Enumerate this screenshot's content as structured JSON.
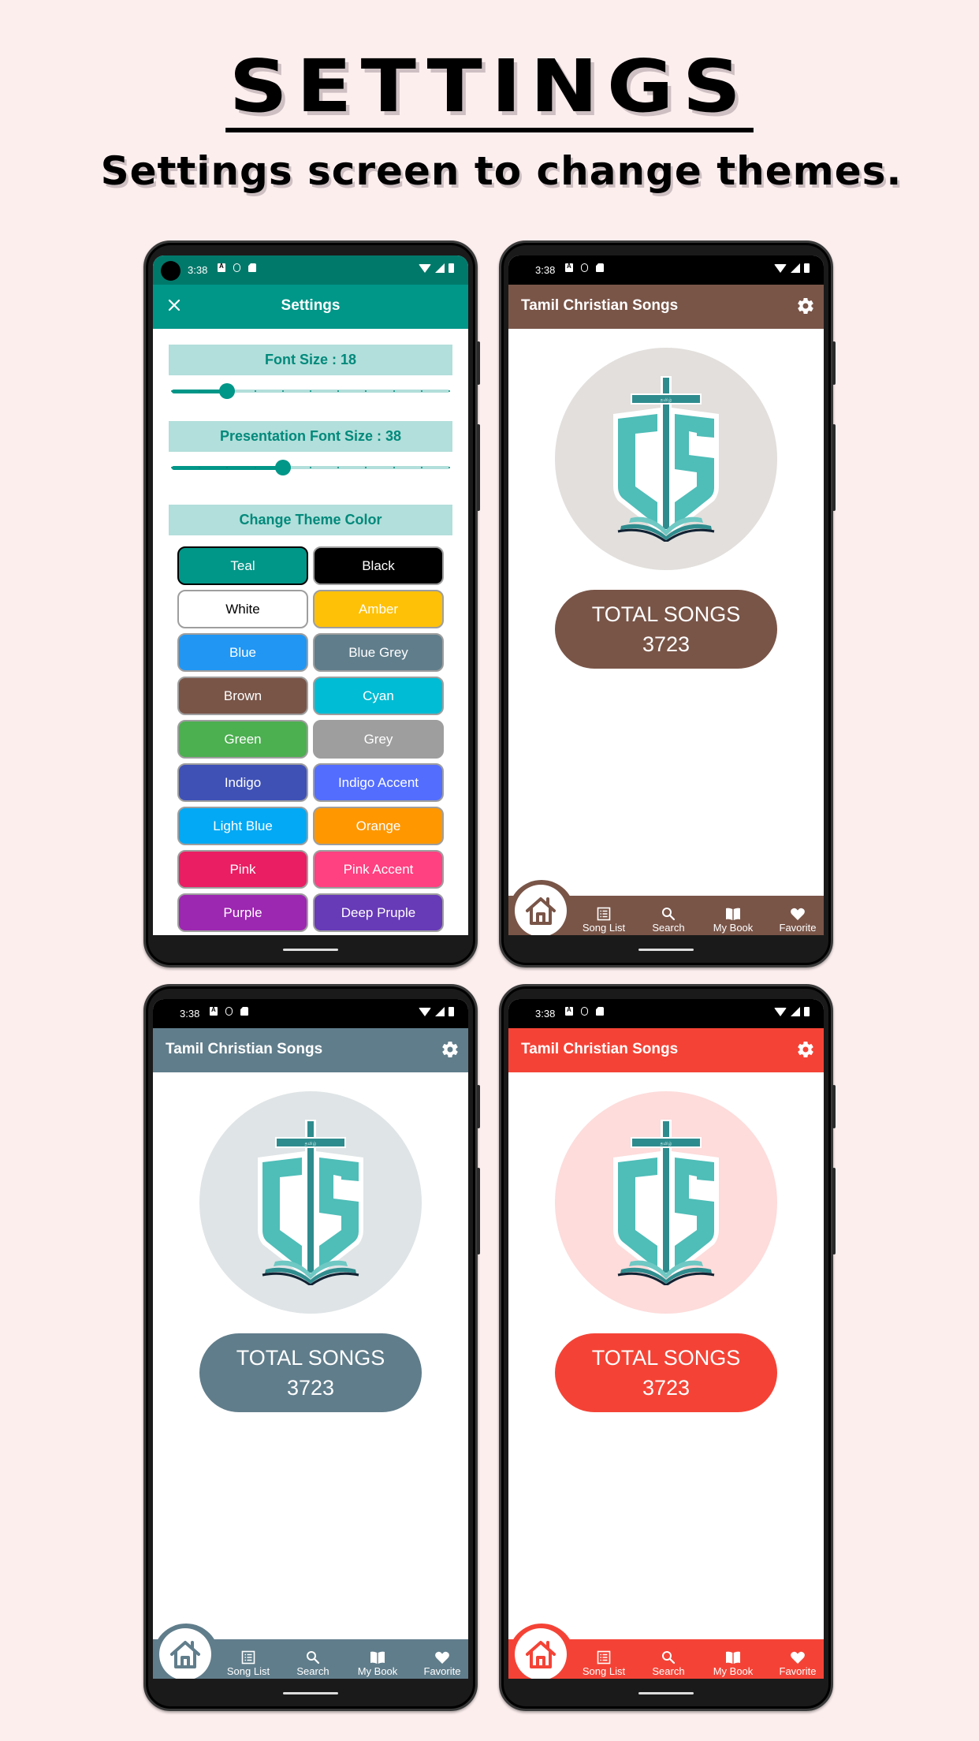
{
  "hero": {
    "title": "SETTINGS",
    "subtitle": "Settings screen to change themes."
  },
  "status_bar": {
    "time": "3:38"
  },
  "settings_screen": {
    "theme_color": "#009688",
    "status_color": "#00796b",
    "title": "Settings",
    "close_icon": "close-icon",
    "font_size_label": "Font Size : 18",
    "font_size_slider_fraction": 0.2,
    "presentation_font_label": "Presentation Font Size : 38",
    "presentation_slider_fraction": 0.4,
    "slider_steps": 10,
    "change_theme_label": "Change Theme Color",
    "colors": [
      {
        "label": "Teal",
        "bg": "#009688",
        "fg": "#ffffff",
        "selected": true
      },
      {
        "label": "Black",
        "bg": "#000000",
        "fg": "#ffffff"
      },
      {
        "label": "White",
        "bg": "#ffffff",
        "fg": "#000000"
      },
      {
        "label": "Amber",
        "bg": "#ffc107",
        "fg": "#ffffff"
      },
      {
        "label": "Blue",
        "bg": "#2196f3",
        "fg": "#ffffff"
      },
      {
        "label": "Blue Grey",
        "bg": "#607d8b",
        "fg": "#ffffff"
      },
      {
        "label": "Brown",
        "bg": "#795548",
        "fg": "#ffffff"
      },
      {
        "label": "Cyan",
        "bg": "#00bcd4",
        "fg": "#ffffff"
      },
      {
        "label": "Green",
        "bg": "#4caf50",
        "fg": "#ffffff"
      },
      {
        "label": "Grey",
        "bg": "#9e9e9e",
        "fg": "#ffffff"
      },
      {
        "label": "Indigo",
        "bg": "#3f51b5",
        "fg": "#ffffff"
      },
      {
        "label": "Indigo Accent",
        "bg": "#536dfe",
        "fg": "#ffffff"
      },
      {
        "label": "Light Blue",
        "bg": "#03a9f4",
        "fg": "#ffffff"
      },
      {
        "label": "Orange",
        "bg": "#ff9800",
        "fg": "#ffffff"
      },
      {
        "label": "Pink",
        "bg": "#e91e63",
        "fg": "#ffffff"
      },
      {
        "label": "Pink Accent",
        "bg": "#ff4081",
        "fg": "#ffffff"
      },
      {
        "label": "Purple",
        "bg": "#9c27b0",
        "fg": "#ffffff"
      },
      {
        "label": "Deep Pruple",
        "bg": "#673ab7",
        "fg": "#ffffff"
      }
    ]
  },
  "home_screens": [
    {
      "theme_name": "Brown",
      "theme_color": "#795548",
      "logo_bg": "#e2dfdc",
      "app_title": "Tamil Christian Songs",
      "total_label": "TOTAL SONGS",
      "total_count": "3723"
    },
    {
      "theme_name": "Blue Grey",
      "theme_color": "#607d8b",
      "logo_bg": "#dfe4e6",
      "app_title": "Tamil Christian Songs",
      "total_label": "TOTAL SONGS",
      "total_count": "3723"
    },
    {
      "theme_name": "Red",
      "theme_color": "#f44336",
      "logo_bg": "#fddcdb",
      "app_title": "Tamil Christian Songs",
      "total_label": "TOTAL SONGS",
      "total_count": "3723"
    }
  ],
  "bottom_nav": {
    "items": [
      {
        "label": "Song List",
        "icon": "list-icon"
      },
      {
        "label": "Search",
        "icon": "search-icon"
      },
      {
        "label": "My Book",
        "icon": "book-icon"
      },
      {
        "label": "Favorite",
        "icon": "heart-icon"
      }
    ],
    "home_icon": "home-icon"
  },
  "logo": {
    "tamil_text": "தமிழ்"
  }
}
